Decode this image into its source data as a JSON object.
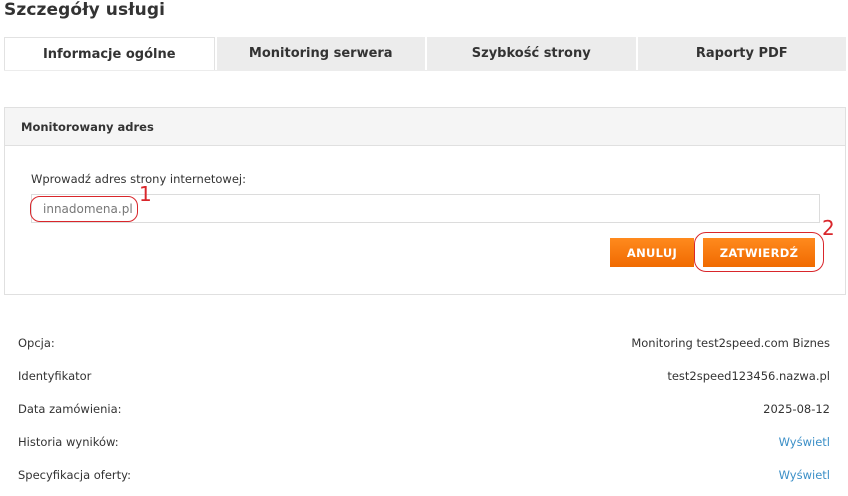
{
  "page": {
    "title": "Szczegóły usługi"
  },
  "tabs": [
    {
      "label": "Informacje ogólne",
      "active": true
    },
    {
      "label": "Monitoring serwera",
      "active": false
    },
    {
      "label": "Szybkość strony",
      "active": false
    },
    {
      "label": "Raporty PDF",
      "active": false
    }
  ],
  "panel": {
    "title": "Monitorowany adres",
    "field_label": "Wprowadź adres strony internetowej:",
    "url_value": "innadomena.pl",
    "cancel_label": "ANULUJ",
    "submit_label": "ZATWIERDŹ"
  },
  "annotations": {
    "marker1": "1",
    "marker2": "2",
    "color": "#d9262b"
  },
  "colors": {
    "accent": "#f47a0d",
    "link": "#3b8fc7"
  },
  "details": [
    {
      "label": "Opcja:",
      "value": "Monitoring test2speed.com Biznes",
      "is_link": false
    },
    {
      "label": "Identyfikator",
      "value": "test2speed123456.nazwa.pl",
      "is_link": false
    },
    {
      "label": "Data zamówienia:",
      "value": "2025-08-12",
      "is_link": false
    },
    {
      "label": "Historia wyników:",
      "value": "Wyświetl",
      "is_link": true
    },
    {
      "label": "Specyfikacja oferty:",
      "value": "Wyświetl",
      "is_link": true
    }
  ]
}
